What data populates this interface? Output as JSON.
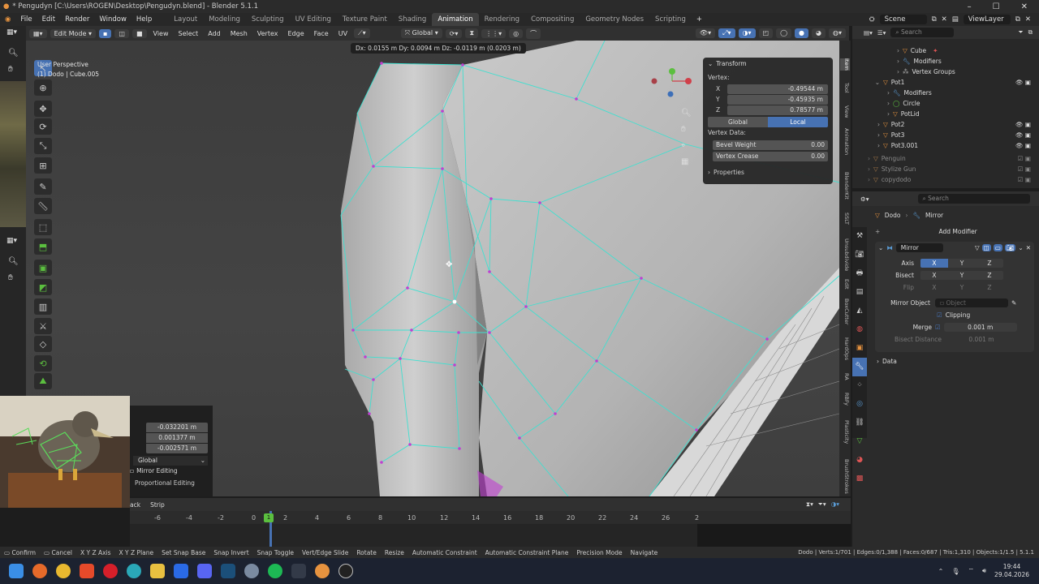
{
  "title": "* Pengudyn [C:\\Users\\ROGEN\\Desktop\\Pengudyn.blend] - Blender 5.1.1",
  "menu": [
    "File",
    "Edit",
    "Render",
    "Window",
    "Help"
  ],
  "workspaces": [
    "Layout",
    "Modeling",
    "Sculpting",
    "UV Editing",
    "Texture Paint",
    "Shading",
    "Animation",
    "Rendering",
    "Compositing",
    "Geometry Nodes",
    "Scripting"
  ],
  "active_workspace": "Animation",
  "scene": "Scene",
  "view_layer": "ViewLayer",
  "viewport_header": {
    "mode": "Edit Mode",
    "menus": [
      "View",
      "Select",
      "Add",
      "Mesh",
      "Vertex",
      "Edge",
      "Face",
      "UV"
    ],
    "orientation": "Global"
  },
  "viewport_info": {
    "line1": "User Perspective",
    "line2": "(1) Dodo | Cube.005"
  },
  "delta_text": "Dx: 0.0155 m  Dy: 0.0094 m  Dz: -0.0119 m (0.0203 m)",
  "npanel": {
    "section": "Transform",
    "vertex_label": "Vertex:",
    "x_label": "X",
    "x": "-0.49544 m",
    "y_label": "Y",
    "y": "-0.45935 m",
    "z_label": "Z",
    "z": "0.78577 m",
    "global": "Global",
    "local": "Local",
    "vertex_data": "Vertex Data:",
    "bevel_label": "Bevel Weight",
    "bevel": "0.00",
    "crease_label": "Vertex Crease",
    "crease": "0.00",
    "properties": "Properties"
  },
  "right_tabs": [
    "Item",
    "Tool",
    "View",
    "Animation",
    "BlenderKit",
    "SSLT",
    "Unsubdivide",
    "Edit",
    "BoxCutter",
    "HardOps",
    "RA",
    "RBFy",
    "Plasticity",
    "BrushStrokes"
  ],
  "outliner": {
    "search_placeholder": "Search",
    "rows": [
      {
        "label": "Cube",
        "indent": 3
      },
      {
        "label": "Modifiers",
        "indent": 3
      },
      {
        "label": "Vertex Groups",
        "indent": 3
      },
      {
        "label": "Pot1",
        "indent": 1
      },
      {
        "label": "Modifiers",
        "indent": 2
      },
      {
        "label": "Circle",
        "indent": 2
      },
      {
        "label": "PotLid",
        "indent": 2
      },
      {
        "label": "Pot2",
        "indent": 1
      },
      {
        "label": "Pot3",
        "indent": 1
      },
      {
        "label": "Pot3.001",
        "indent": 1
      },
      {
        "label": "Penguin",
        "indent": 0
      },
      {
        "label": "Stylize Gun",
        "indent": 0
      },
      {
        "label": "copydodo",
        "indent": 0
      }
    ]
  },
  "properties": {
    "search_placeholder": "Search",
    "breadcrumb_obj": "Dodo",
    "breadcrumb_mod": "Mirror",
    "add_modifier": "Add Modifier",
    "modifier_name": "Mirror",
    "axis_label": "Axis",
    "bisect_label": "Bisect",
    "flip_label": "Flip",
    "axes": [
      "X",
      "Y",
      "Z"
    ],
    "mirror_object_label": "Mirror Object",
    "mirror_object_placeholder": "Object",
    "clipping": "Clipping",
    "merge_label": "Merge",
    "merge_value": "0.001 m",
    "bisect_distance_label": "Bisect Distance",
    "bisect_distance_value": "0.001 m",
    "data": "Data"
  },
  "redo": {
    "values": [
      "-0.032201 m",
      "0.001377 m",
      "-0.002571 m"
    ],
    "orientation": "Global",
    "mirror_editing": "Mirror Editing",
    "proportional": "Proportional Editing"
  },
  "timeline": {
    "hdr_left": "ack",
    "hdr_strip": "Strip",
    "ticks": [
      "-6",
      "-4",
      "-2",
      "0",
      "1",
      "2",
      "4",
      "6",
      "8",
      "10",
      "12",
      "14",
      "16",
      "18",
      "20",
      "22",
      "24",
      "26",
      "2"
    ],
    "current_frame": "1"
  },
  "statusbar": [
    "Confirm",
    "Cancel",
    "X Y Z Axis",
    "X Y Z Plane",
    "Set Snap Base",
    "Snap Invert",
    "Snap Toggle",
    "Vert/Edge Slide",
    "Rotate",
    "Resize",
    "Automatic Constraint",
    "Automatic Constraint Plane",
    "Precision Mode",
    "Navigate"
  ],
  "stats": "Dodo | Verts:1/701 | Edges:0/1,388 | Faces:0/687 | Tris:1,310 | Objects:1/1.5 | 5.1.1",
  "clock": {
    "time": "19:44",
    "date": "29.04.2026"
  },
  "colors": {
    "accent": "#4772b3",
    "wire": "#3fe0d0",
    "vert": "#c040d0",
    "orange": "#e7933f"
  }
}
